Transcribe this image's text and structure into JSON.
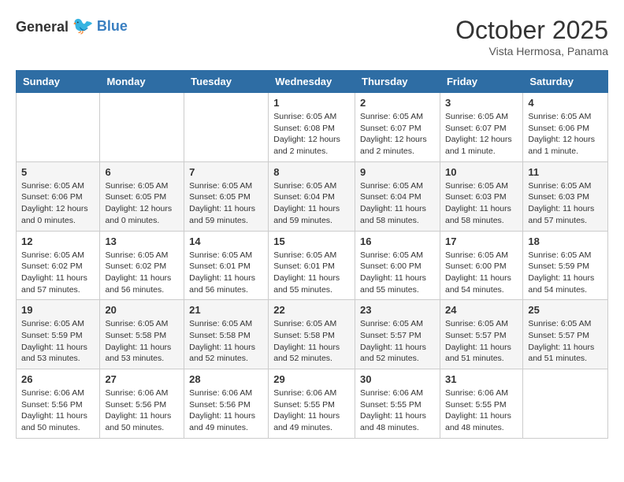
{
  "header": {
    "logo_general": "General",
    "logo_blue": "Blue",
    "month_title": "October 2025",
    "location": "Vista Hermosa, Panama"
  },
  "days_of_week": [
    "Sunday",
    "Monday",
    "Tuesday",
    "Wednesday",
    "Thursday",
    "Friday",
    "Saturday"
  ],
  "weeks": [
    [
      {
        "day": "",
        "info": ""
      },
      {
        "day": "",
        "info": ""
      },
      {
        "day": "",
        "info": ""
      },
      {
        "day": "1",
        "info": "Sunrise: 6:05 AM\nSunset: 6:08 PM\nDaylight: 12 hours and 2 minutes."
      },
      {
        "day": "2",
        "info": "Sunrise: 6:05 AM\nSunset: 6:07 PM\nDaylight: 12 hours and 2 minutes."
      },
      {
        "day": "3",
        "info": "Sunrise: 6:05 AM\nSunset: 6:07 PM\nDaylight: 12 hours and 1 minute."
      },
      {
        "day": "4",
        "info": "Sunrise: 6:05 AM\nSunset: 6:06 PM\nDaylight: 12 hours and 1 minute."
      }
    ],
    [
      {
        "day": "5",
        "info": "Sunrise: 6:05 AM\nSunset: 6:06 PM\nDaylight: 12 hours and 0 minutes."
      },
      {
        "day": "6",
        "info": "Sunrise: 6:05 AM\nSunset: 6:05 PM\nDaylight: 12 hours and 0 minutes."
      },
      {
        "day": "7",
        "info": "Sunrise: 6:05 AM\nSunset: 6:05 PM\nDaylight: 11 hours and 59 minutes."
      },
      {
        "day": "8",
        "info": "Sunrise: 6:05 AM\nSunset: 6:04 PM\nDaylight: 11 hours and 59 minutes."
      },
      {
        "day": "9",
        "info": "Sunrise: 6:05 AM\nSunset: 6:04 PM\nDaylight: 11 hours and 58 minutes."
      },
      {
        "day": "10",
        "info": "Sunrise: 6:05 AM\nSunset: 6:03 PM\nDaylight: 11 hours and 58 minutes."
      },
      {
        "day": "11",
        "info": "Sunrise: 6:05 AM\nSunset: 6:03 PM\nDaylight: 11 hours and 57 minutes."
      }
    ],
    [
      {
        "day": "12",
        "info": "Sunrise: 6:05 AM\nSunset: 6:02 PM\nDaylight: 11 hours and 57 minutes."
      },
      {
        "day": "13",
        "info": "Sunrise: 6:05 AM\nSunset: 6:02 PM\nDaylight: 11 hours and 56 minutes."
      },
      {
        "day": "14",
        "info": "Sunrise: 6:05 AM\nSunset: 6:01 PM\nDaylight: 11 hours and 56 minutes."
      },
      {
        "day": "15",
        "info": "Sunrise: 6:05 AM\nSunset: 6:01 PM\nDaylight: 11 hours and 55 minutes."
      },
      {
        "day": "16",
        "info": "Sunrise: 6:05 AM\nSunset: 6:00 PM\nDaylight: 11 hours and 55 minutes."
      },
      {
        "day": "17",
        "info": "Sunrise: 6:05 AM\nSunset: 6:00 PM\nDaylight: 11 hours and 54 minutes."
      },
      {
        "day": "18",
        "info": "Sunrise: 6:05 AM\nSunset: 5:59 PM\nDaylight: 11 hours and 54 minutes."
      }
    ],
    [
      {
        "day": "19",
        "info": "Sunrise: 6:05 AM\nSunset: 5:59 PM\nDaylight: 11 hours and 53 minutes."
      },
      {
        "day": "20",
        "info": "Sunrise: 6:05 AM\nSunset: 5:58 PM\nDaylight: 11 hours and 53 minutes."
      },
      {
        "day": "21",
        "info": "Sunrise: 6:05 AM\nSunset: 5:58 PM\nDaylight: 11 hours and 52 minutes."
      },
      {
        "day": "22",
        "info": "Sunrise: 6:05 AM\nSunset: 5:58 PM\nDaylight: 11 hours and 52 minutes."
      },
      {
        "day": "23",
        "info": "Sunrise: 6:05 AM\nSunset: 5:57 PM\nDaylight: 11 hours and 52 minutes."
      },
      {
        "day": "24",
        "info": "Sunrise: 6:05 AM\nSunset: 5:57 PM\nDaylight: 11 hours and 51 minutes."
      },
      {
        "day": "25",
        "info": "Sunrise: 6:05 AM\nSunset: 5:57 PM\nDaylight: 11 hours and 51 minutes."
      }
    ],
    [
      {
        "day": "26",
        "info": "Sunrise: 6:06 AM\nSunset: 5:56 PM\nDaylight: 11 hours and 50 minutes."
      },
      {
        "day": "27",
        "info": "Sunrise: 6:06 AM\nSunset: 5:56 PM\nDaylight: 11 hours and 50 minutes."
      },
      {
        "day": "28",
        "info": "Sunrise: 6:06 AM\nSunset: 5:56 PM\nDaylight: 11 hours and 49 minutes."
      },
      {
        "day": "29",
        "info": "Sunrise: 6:06 AM\nSunset: 5:55 PM\nDaylight: 11 hours and 49 minutes."
      },
      {
        "day": "30",
        "info": "Sunrise: 6:06 AM\nSunset: 5:55 PM\nDaylight: 11 hours and 48 minutes."
      },
      {
        "day": "31",
        "info": "Sunrise: 6:06 AM\nSunset: 5:55 PM\nDaylight: 11 hours and 48 minutes."
      },
      {
        "day": "",
        "info": ""
      }
    ]
  ]
}
